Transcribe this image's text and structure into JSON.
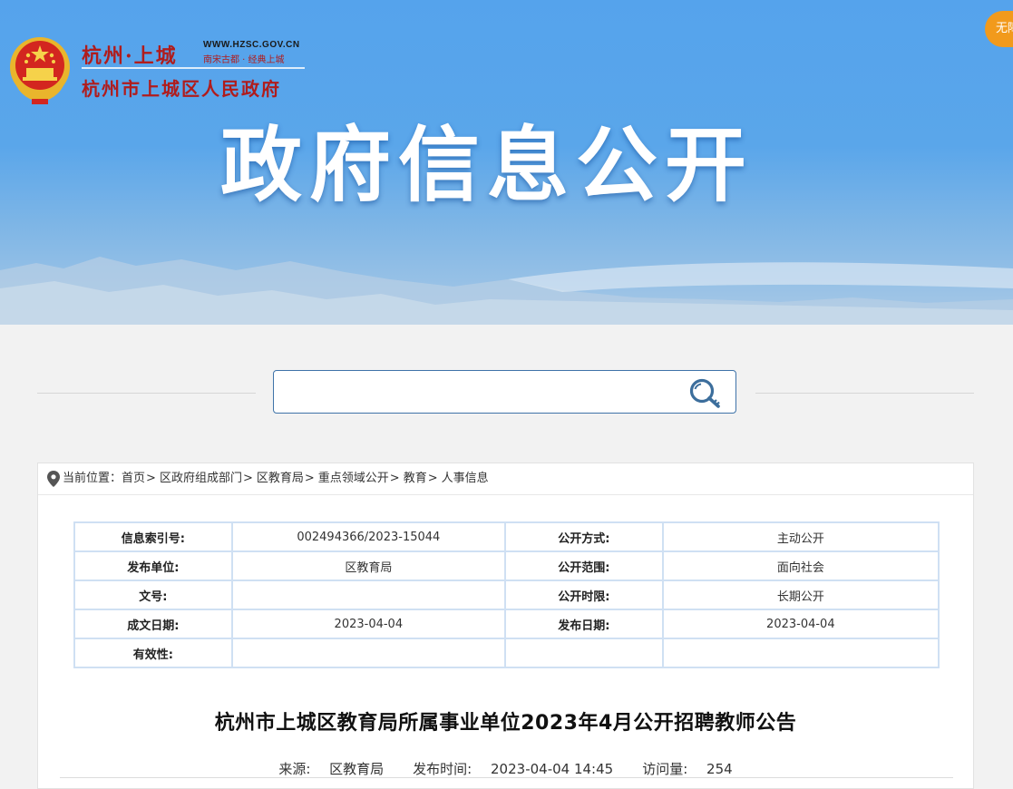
{
  "header": {
    "logo_city": "杭州·上城",
    "logo_url": "WWW.HZSC.GOV.CN",
    "logo_slogan": "南宋古都 · 经典上城",
    "logo_gov": "杭州市上城区人民政府",
    "banner_title": "政府信息公开",
    "accessibility_label": "无障碍"
  },
  "search": {
    "value": "",
    "placeholder": "",
    "icon": "search-key-icon"
  },
  "breadcrumb": {
    "prefix": "当前位置：",
    "items": [
      "首页",
      "区政府组成部门",
      "区教育局",
      "重点领域公开",
      "教育",
      "人事信息"
    ],
    "separator": ">"
  },
  "meta_table": {
    "rows": [
      {
        "label1": "信息索引号:",
        "value1": "002494366/2023-15044",
        "label2": "公开方式:",
        "value2": "主动公开"
      },
      {
        "label1": "发布单位:",
        "value1": "区教育局",
        "label2": "公开范围:",
        "value2": "面向社会"
      },
      {
        "label1": "文号:",
        "value1": "",
        "label2": "公开时限:",
        "value2": "长期公开"
      },
      {
        "label1": "成文日期:",
        "value1": "2023-04-04",
        "label2": "发布日期:",
        "value2": "2023-04-04"
      },
      {
        "label1": "有效性:",
        "value1": "",
        "label2": "",
        "value2": ""
      }
    ]
  },
  "article": {
    "title": "杭州市上城区教育局所属事业单位2023年4月公开招聘教师公告",
    "source_label": "来源:",
    "source": "区教育局",
    "time_label": "发布时间:",
    "time": "2023-04-04 14:45",
    "views_label": "访问量:",
    "views": "254"
  },
  "colors": {
    "banner_blue": "#55a3ec",
    "logo_red": "#b01c1c",
    "accessibility_orange": "#f29a1c",
    "search_border": "#3f73a8",
    "table_border": "#cfe0f3"
  }
}
